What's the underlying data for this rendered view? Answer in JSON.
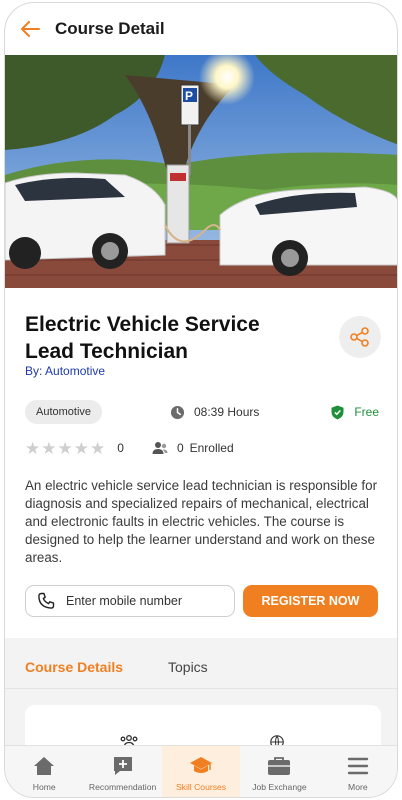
{
  "header": {
    "title": "Course Detail"
  },
  "course": {
    "title": "Electric Vehicle Service Lead Technician",
    "byline": "By: Automotive",
    "category": "Automotive",
    "duration": "08:39 Hours",
    "price": "Free",
    "rating": {
      "stars_total": 5,
      "stars_filled": 0,
      "count": "0"
    },
    "enrolled_count": "0",
    "enrolled_label": "Enrolled",
    "description": "An electric vehicle service lead technician is responsible for diagnosis and specialized repairs of mechanical, electrical and electronic faults in electric vehicles. The course is designed to help the learner understand and work on these areas."
  },
  "register": {
    "placeholder": "Enter mobile number",
    "button_label": "REGISTER NOW"
  },
  "tabs": [
    {
      "label": "Course Details",
      "active": true
    },
    {
      "label": "Topics",
      "active": false
    }
  ],
  "bottom_nav": [
    {
      "label": "Home",
      "icon": "home-icon",
      "active": false
    },
    {
      "label": "Recommendation",
      "icon": "recommendation-icon",
      "active": false
    },
    {
      "label": "Skill Courses",
      "icon": "graduation-cap-icon",
      "active": true
    },
    {
      "label": "Job Exchange",
      "icon": "briefcase-icon",
      "active": false
    },
    {
      "label": "More",
      "icon": "menu-icon",
      "active": false
    }
  ],
  "colors": {
    "accent": "#F07F22",
    "link": "#1E3AA8",
    "free_green": "#1F8F3A"
  }
}
